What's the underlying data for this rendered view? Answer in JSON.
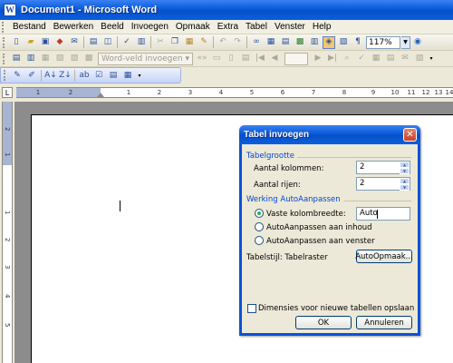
{
  "window": {
    "title": "Document1 - Microsoft Word",
    "app_icon": "W"
  },
  "menu": [
    "Bestand",
    "Bewerken",
    "Beeld",
    "Invoegen",
    "Opmaak",
    "Extra",
    "Tabel",
    "Venster",
    "Help"
  ],
  "toolbar": {
    "zoom": "117%",
    "paragraph_mark": "¶"
  },
  "toolbar2": {
    "field_label": "Word-veld invoegen ▾"
  },
  "ruler": {
    "tab_selector": "L",
    "numbers": [
      "1",
      "2",
      "1",
      "2",
      "3",
      "4",
      "5",
      "6",
      "7",
      "8",
      "9",
      "10",
      "11",
      "12",
      "13",
      "14"
    ]
  },
  "vruler": {
    "numbers": [
      "2",
      "1",
      "1",
      "2",
      "3",
      "4",
      "5"
    ]
  },
  "dialog": {
    "title": "Tabel invoegen",
    "group_size": "Tabelgrootte",
    "columns_label": "Aantal kolommen:",
    "columns_value": "2",
    "rows_label": "Aantal rijen:",
    "rows_value": "2",
    "group_autofit": "Werking AutoAanpassen",
    "opt_fixed": "Vaste kolombreedte:",
    "fixed_value": "Auto",
    "opt_content": "AutoAanpassen aan inhoud",
    "opt_window": "AutoAanpassen aan venster",
    "table_style_label": "Tabelstijl: Tabelraster",
    "autoformat_btn": "AutoOpmaak...",
    "remember_label": "Dimensies voor nieuwe tabellen opslaan",
    "ok": "OK",
    "cancel": "Annuleren"
  }
}
